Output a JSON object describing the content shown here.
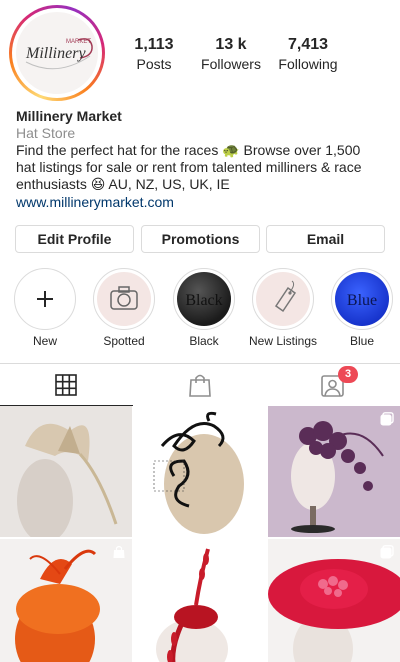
{
  "profile": {
    "logo_text": "Millinery",
    "logo_sub": "MARKET",
    "stats": [
      {
        "value": "1,113",
        "label": "Posts"
      },
      {
        "value": "13 k",
        "label": "Followers"
      },
      {
        "value": "7,413",
        "label": "Following"
      }
    ]
  },
  "bio": {
    "name": "Millinery Market",
    "category": "Hat Store",
    "text_line1": "Find the perfect hat for the races 🐢 Browse over 1,500",
    "text_line2": "hat listings for sale or rent from talented milliners & race",
    "text_line3": "enthusiasts 😆 AU, NZ, US, UK, IE",
    "link": "www.millinerymarket.com"
  },
  "buttons": {
    "edit_profile": "Edit Profile",
    "promotions": "Promotions",
    "email": "Email"
  },
  "highlights": [
    {
      "label": "New",
      "icon": "plus-icon"
    },
    {
      "label": "Spotted",
      "icon": "camera-icon"
    },
    {
      "label": "Black",
      "text": "Black"
    },
    {
      "label": "New Listings",
      "icon": "tag-icon"
    },
    {
      "label": "Blue",
      "text": "Blue"
    }
  ],
  "tabs": {
    "grid_icon": "grid-icon",
    "shop_icon": "shopping-bag-icon",
    "tagged_icon": "tagged-person-icon",
    "tagged_badge": "3"
  },
  "colors": {
    "badge": "#ed4956",
    "link": "#00376b",
    "border": "#dbdbdb"
  }
}
